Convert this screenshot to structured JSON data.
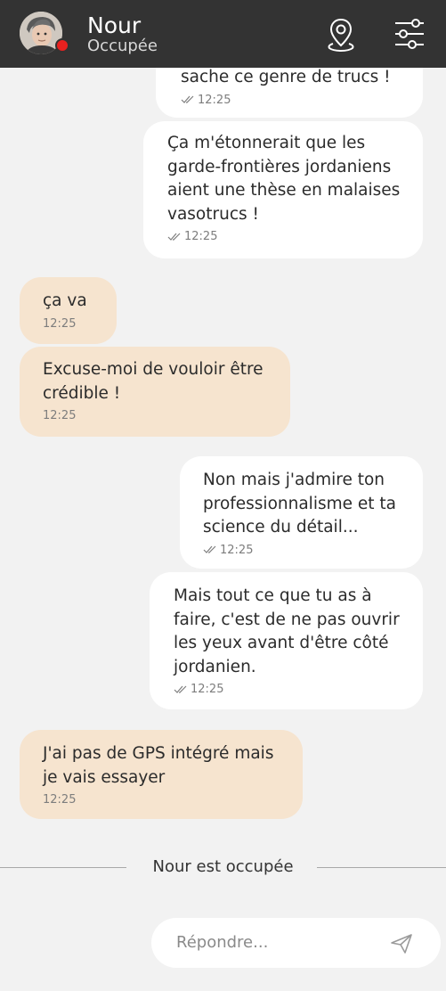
{
  "header": {
    "contact_name": "Nour",
    "contact_status": "Occupée",
    "status_color": "#e8211f"
  },
  "icons": {
    "location": "map-pin-icon",
    "settings": "sliders-icon",
    "read": "double-check-icon",
    "send": "paper-plane-icon"
  },
  "messages": [
    {
      "direction": "outgoing",
      "text": "sache ce genre de trucs !",
      "time": "12:25",
      "read": true
    },
    {
      "direction": "outgoing",
      "text": "Ça m'étonnerait que les\ngarde-frontières jordaniens\naient une thèse en malaises\nvasotrucs !",
      "time": "12:25",
      "read": true
    },
    {
      "direction": "incoming",
      "text": "ça va",
      "time": "12:25"
    },
    {
      "direction": "incoming",
      "text": "Excuse-moi de vouloir être\ncrédible !",
      "time": "12:25"
    },
    {
      "direction": "outgoing",
      "text": "Non mais j'admire ton\nprofessionnalisme et ta\nscience du détail...",
      "time": "12:25",
      "read": true
    },
    {
      "direction": "outgoing",
      "text": "Mais tout ce que tu as à\nfaire, c'est de ne pas ouvrir\nles yeux avant d'être côté\njordanien.",
      "time": "12:25",
      "read": true
    },
    {
      "direction": "incoming",
      "text": "J'ai pas de GPS intégré mais\nje vais essayer",
      "time": "12:25"
    }
  ],
  "separator": {
    "text": "Nour est occupée"
  },
  "reply": {
    "placeholder": "Répondre..."
  },
  "colors": {
    "header_bg": "#333333",
    "outgoing_bubble": "#ffffff",
    "incoming_bubble": "#f6e4cf",
    "background": "#f2f2f2"
  }
}
